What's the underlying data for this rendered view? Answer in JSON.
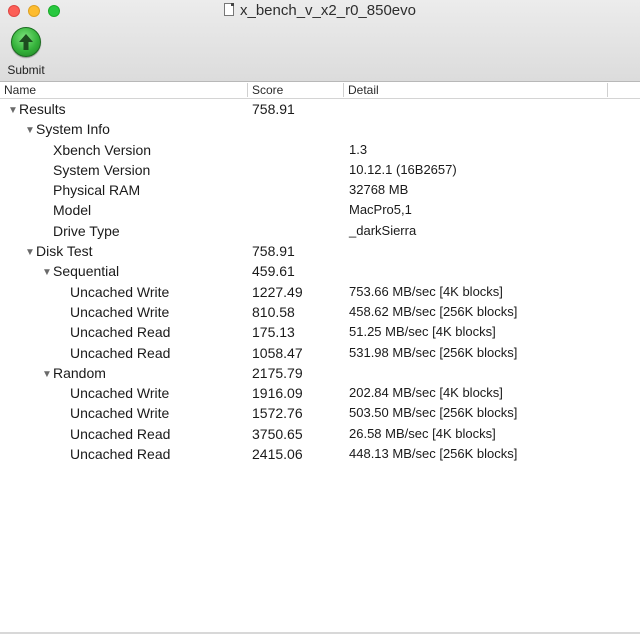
{
  "window": {
    "title": "x_bench_v_x2_r0_850evo"
  },
  "toolbar": {
    "submit_label": "Submit",
    "submit_icon": "arrow-up-icon",
    "submit_color": "#34b23a"
  },
  "columns": {
    "name": "Name",
    "score": "Score",
    "detail": "Detail"
  },
  "rows": [
    {
      "name": "Results",
      "score": "758.91",
      "detail": ""
    },
    {
      "name": "System Info",
      "score": "",
      "detail": ""
    },
    {
      "name": "Xbench Version",
      "score": "",
      "detail": "1.3"
    },
    {
      "name": "System Version",
      "score": "",
      "detail": "10.12.1 (16B2657)"
    },
    {
      "name": "Physical RAM",
      "score": "",
      "detail": "32768 MB"
    },
    {
      "name": "Model",
      "score": "",
      "detail": "MacPro5,1"
    },
    {
      "name": "Drive Type",
      "score": "",
      "detail": "_darkSierra"
    },
    {
      "name": "Disk Test",
      "score": "758.91",
      "detail": ""
    },
    {
      "name": "Sequential",
      "score": "459.61",
      "detail": ""
    },
    {
      "name": "Uncached Write",
      "score": "1227.49",
      "detail": "753.66 MB/sec [4K blocks]"
    },
    {
      "name": "Uncached Write",
      "score": "810.58",
      "detail": "458.62 MB/sec [256K blocks]"
    },
    {
      "name": "Uncached Read",
      "score": "175.13",
      "detail": "51.25 MB/sec [4K blocks]"
    },
    {
      "name": "Uncached Read",
      "score": "1058.47",
      "detail": "531.98 MB/sec [256K blocks]"
    },
    {
      "name": "Random",
      "score": "2175.79",
      "detail": ""
    },
    {
      "name": "Uncached Write",
      "score": "1916.09",
      "detail": "202.84 MB/sec [4K blocks]"
    },
    {
      "name": "Uncached Write",
      "score": "1572.76",
      "detail": "503.50 MB/sec [256K blocks]"
    },
    {
      "name": "Uncached Read",
      "score": "3750.65",
      "detail": "26.58 MB/sec [4K blocks]"
    },
    {
      "name": "Uncached Read",
      "score": "2415.06",
      "detail": "448.13 MB/sec [256K blocks]"
    }
  ]
}
